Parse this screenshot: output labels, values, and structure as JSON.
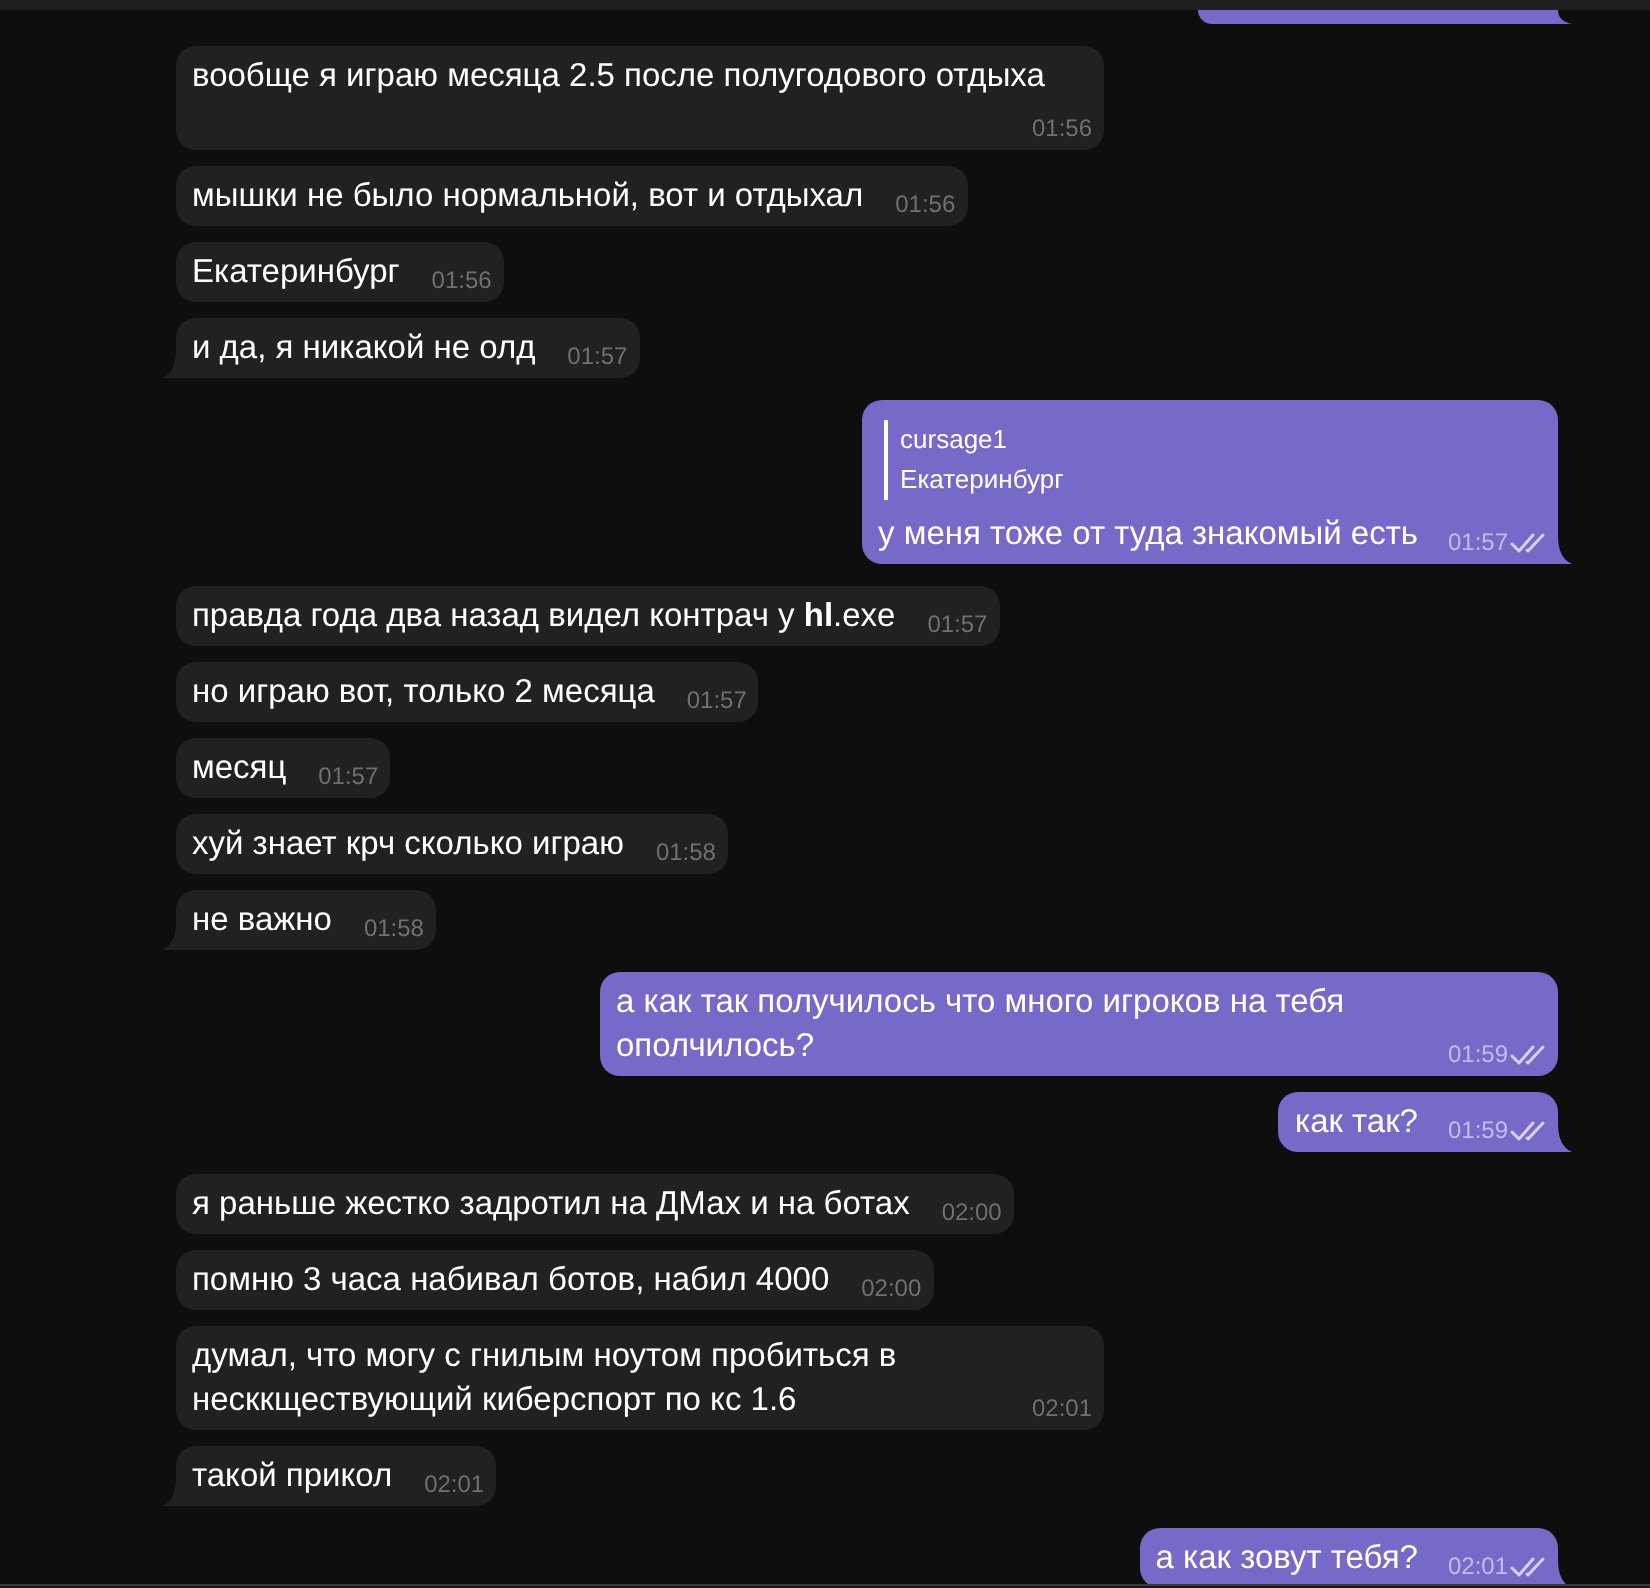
{
  "chat": {
    "groups": [
      {
        "outgoing": true,
        "messages": [
          {
            "kind": "fragment"
          }
        ]
      },
      {
        "outgoing": false,
        "messages": [
          {
            "kind": "text",
            "text": "вообще я играю месяца 2.5 после полугодового отдыха",
            "time": "01:56"
          },
          {
            "kind": "text",
            "text": "мышки не было нормальной, вот и отдыхал",
            "time": "01:56"
          },
          {
            "kind": "text",
            "text": "Екатеринбург",
            "time": "01:56"
          },
          {
            "kind": "text",
            "text": "и да, я никакой не олд",
            "time": "01:57"
          }
        ]
      },
      {
        "outgoing": true,
        "messages": [
          {
            "kind": "text",
            "reply": {
              "author": "cursage1",
              "text": "Екатеринбург"
            },
            "text": "у меня тоже от туда знакомый есть",
            "time": "01:57",
            "read": true
          }
        ]
      },
      {
        "outgoing": false,
        "messages": [
          {
            "kind": "text",
            "text": "правда года два назад видел контрач у **hl**.exe",
            "time": "01:57"
          },
          {
            "kind": "text",
            "text": "но играю вот, только 2 месяца",
            "time": "01:57"
          },
          {
            "kind": "text",
            "text": "месяц",
            "time": "01:57"
          },
          {
            "kind": "text",
            "text": "хуй знает крч сколько играю",
            "time": "01:58"
          },
          {
            "kind": "text",
            "text": "не важно",
            "time": "01:58"
          }
        ]
      },
      {
        "outgoing": true,
        "messages": [
          {
            "kind": "text",
            "text": "а как так получилось что много игроков на тебя ополчилось?",
            "time": "01:59",
            "read": true
          },
          {
            "kind": "text",
            "text": "как так?",
            "time": "01:59",
            "read": true
          }
        ]
      },
      {
        "outgoing": false,
        "messages": [
          {
            "kind": "text",
            "text": "я раньше жестко задротил на ДМах и на ботах",
            "time": "02:00"
          },
          {
            "kind": "text",
            "text": "помню 3 часа набивал ботов, набил 4000",
            "time": "02:00"
          },
          {
            "kind": "text",
            "text": "думал, что могу с гнилым ноутом пробиться в несккществующий киберспорт по кс 1.6",
            "time": "02:01"
          },
          {
            "kind": "text",
            "text": "такой прикол",
            "time": "02:01"
          }
        ]
      },
      {
        "outgoing": true,
        "messages": [
          {
            "kind": "text",
            "text": "а как зовут тебя?",
            "time": "02:01",
            "read": true
          }
        ]
      }
    ]
  }
}
